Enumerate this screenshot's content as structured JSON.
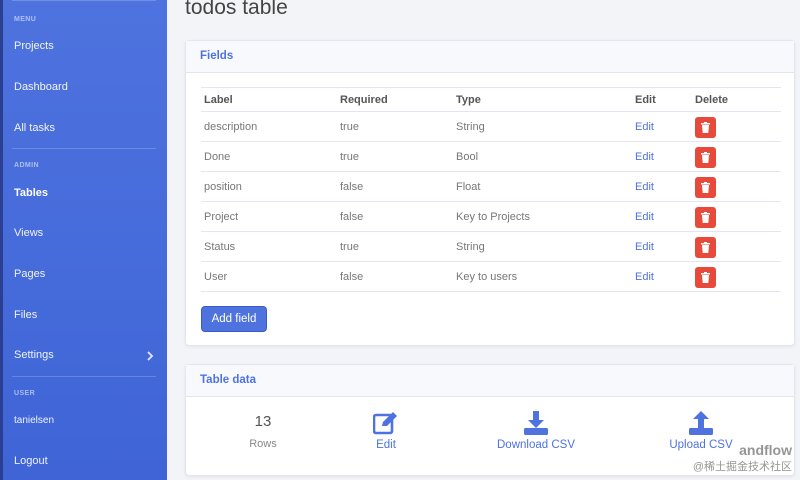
{
  "sidebar": {
    "menu_heading": "MENU",
    "admin_heading": "ADMIN",
    "user_heading": "USER",
    "items": [
      {
        "label": "Projects"
      },
      {
        "label": "Dashboard"
      },
      {
        "label": "All tasks"
      },
      {
        "label": "Tables"
      },
      {
        "label": "Views"
      },
      {
        "label": "Pages"
      },
      {
        "label": "Files"
      },
      {
        "label": "Settings"
      },
      {
        "label": "tanielsen"
      },
      {
        "label": "Logout"
      }
    ]
  },
  "page": {
    "title": "todos table"
  },
  "fields_card": {
    "title": "Fields",
    "columns": [
      "Label",
      "Required",
      "Type",
      "Edit",
      "Delete"
    ],
    "rows": [
      {
        "label": "description",
        "required": "true",
        "type": "String",
        "edit": "Edit"
      },
      {
        "label": "Done",
        "required": "true",
        "type": "Bool",
        "edit": "Edit"
      },
      {
        "label": "position",
        "required": "false",
        "type": "Float",
        "edit": "Edit"
      },
      {
        "label": "Project",
        "required": "false",
        "type": "Key to Projects",
        "edit": "Edit"
      },
      {
        "label": "Status",
        "required": "true",
        "type": "String",
        "edit": "Edit"
      },
      {
        "label": "User",
        "required": "false",
        "type": "Key to users",
        "edit": "Edit"
      }
    ],
    "add_button": "Add field"
  },
  "data_card": {
    "title": "Table data",
    "rows_count": "13",
    "rows_label": "Rows",
    "edit_label": "Edit",
    "download_label": "Download CSV",
    "upload_label": "Upload CSV"
  },
  "watermark": {
    "line1": "andflow",
    "line2": "@稀土掘金技术社区"
  },
  "colors": {
    "primary": "#4e73df",
    "danger": "#e74a3b"
  }
}
